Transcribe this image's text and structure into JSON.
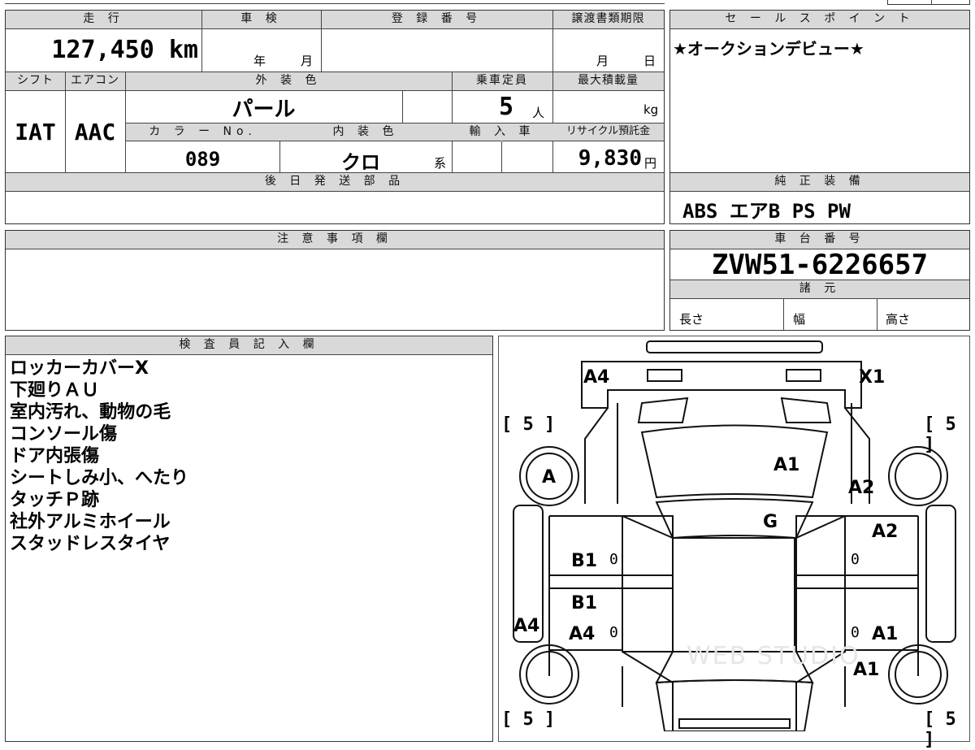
{
  "vehicle": {
    "mileage_label": "走 行",
    "mileage_value": "127,450 km",
    "inspection_label": "車 検",
    "inspection_year": "年",
    "inspection_month": "月",
    "registration_label": "登 録 番 号",
    "transfer_label": "譲渡書類期限",
    "transfer_month": "月",
    "transfer_day": "日",
    "shift_label": "シフト",
    "shift_value": "IAT",
    "ac_label": "エアコン",
    "ac_value": "AAC",
    "exterior_label": "外 装 色",
    "exterior_value": "パール",
    "capacity_label": "乗車定員",
    "capacity_value": "5",
    "capacity_unit": "人",
    "load_label": "最大積載量",
    "load_unit": "kg",
    "color_no_label": "カ ラ ー No.",
    "color_no_value": "089",
    "interior_label": "内 装 色",
    "interior_value": "クロ",
    "interior_unit": "系",
    "import_label": "輸 入 車",
    "recycle_label": "リサイクル預託金",
    "recycle_value": "9,830",
    "recycle_unit": "円",
    "later_parts_label": "後 日 発 送 部 品"
  },
  "sales": {
    "label": "セ ー ル ス ポ イ ン ト",
    "text": "★オークションデビュー★"
  },
  "equipment": {
    "label": "純 正 装 備",
    "value": "ABS エアB PS PW"
  },
  "caution": {
    "label": "注 意 事 項 欄"
  },
  "chassis": {
    "label": "車 台 番 号",
    "value": "ZVW51-6226657",
    "specs_label": "諸 元",
    "length_label": "長さ",
    "width_label": "幅",
    "height_label": "高さ"
  },
  "inspector": {
    "label": "検 査 員 記 入 欄",
    "notes": [
      "ロッカーカバーX",
      "下廻りＡＵ",
      "室内汚れ、動物の毛",
      "コンソール傷",
      "ドア内張傷",
      "シートしみ小、へたり",
      "タッチＰ跡",
      "社外アルミホイール",
      "スタッドレスタイヤ"
    ]
  },
  "diagram": {
    "tl": "A4",
    "tr": "X1",
    "tire_fl": "5",
    "tire_fr": "5",
    "tire_rl": "5",
    "tire_rr": "5",
    "wheel_fl_mark": "A",
    "hood": "A1",
    "fender_fr": "A2",
    "windshield": "G",
    "door_fr": "A2",
    "door_fl": "B1",
    "door_fl_zero": "0",
    "door_fr_zero": "0",
    "door_rl_a": "B1",
    "door_rl_b": "A4",
    "door_rl_zero": "0",
    "quarter_l": "A4",
    "door_rr_zero": "0",
    "door_rr": "A1",
    "quarter_r": "A1",
    "watermark": "WEB STUDIO"
  }
}
